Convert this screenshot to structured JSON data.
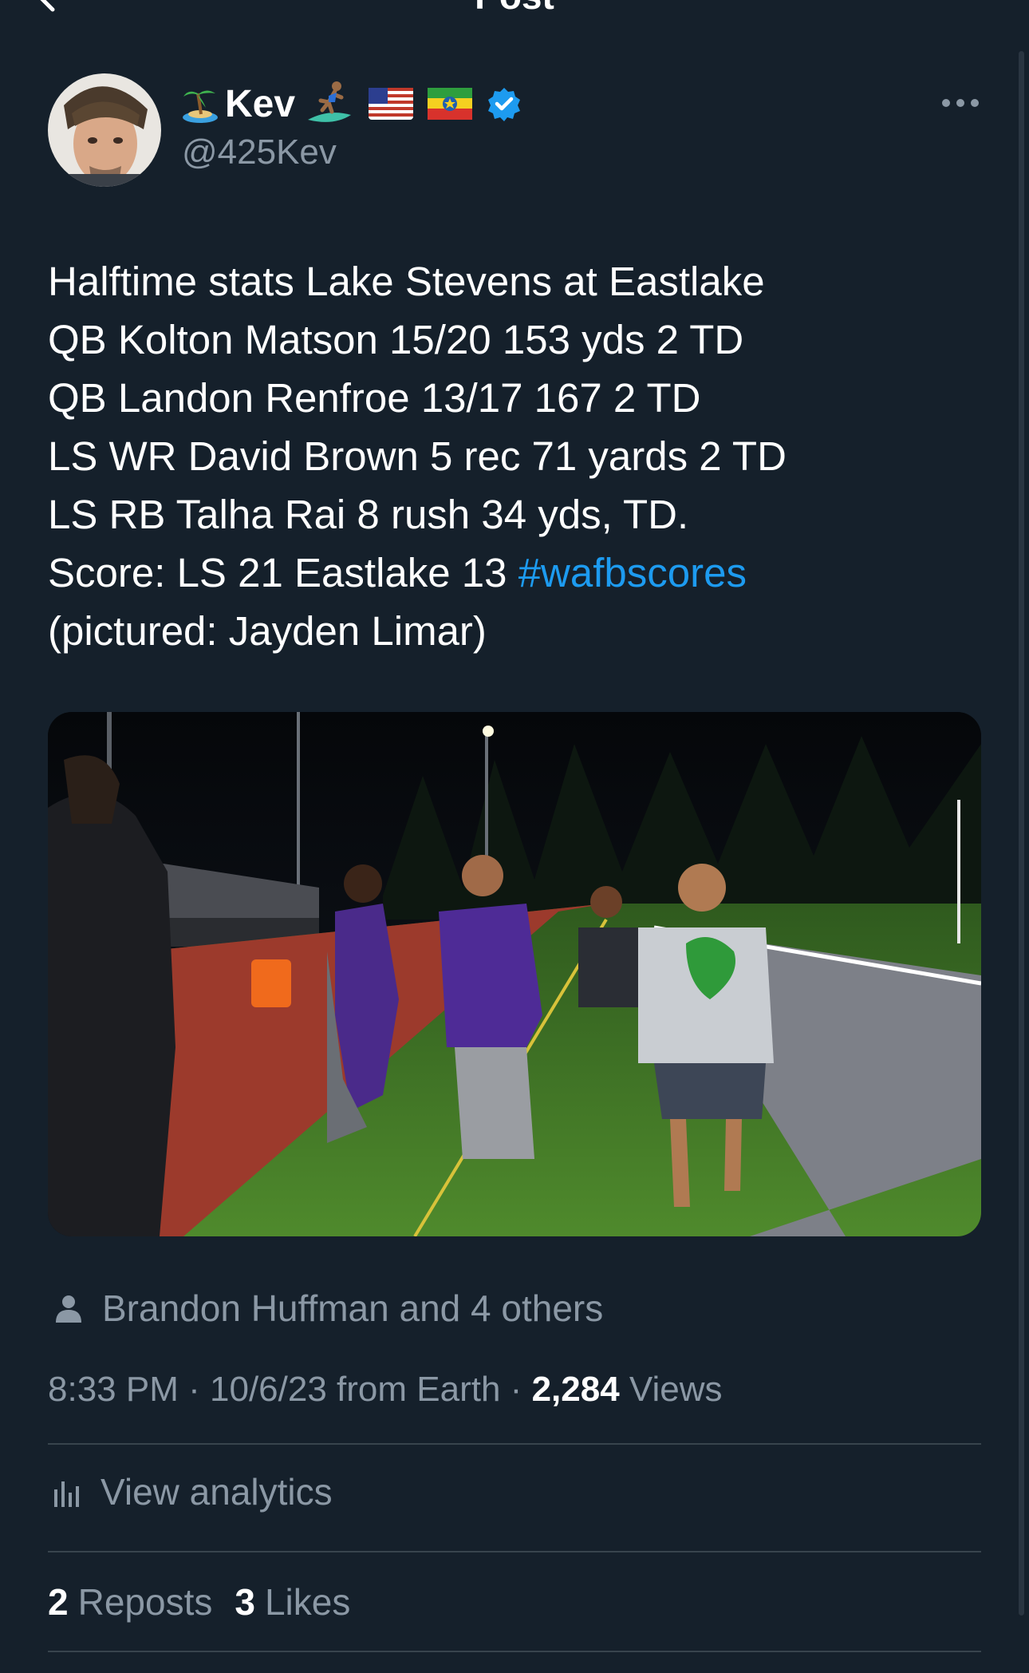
{
  "header": {
    "title": "Post"
  },
  "author": {
    "display_name": "Kev",
    "handle": "@425Kev",
    "emojis": [
      "island-emoji",
      "surfer-emoji",
      "us-flag-emoji",
      "ethiopia-flag-emoji"
    ],
    "verified": true
  },
  "tweet": {
    "lines": [
      "Halftime stats Lake Stevens at Eastlake",
      "QB Kolton Matson 15/20 153 yds 2 TD",
      "QB Landon Renfroe 13/17 167 2 TD",
      "LS WR David Brown 5 rec 71 yards 2 TD",
      "LS RB Talha Rai 8 rush 34 yds, TD."
    ],
    "score_line": "Score: LS 21 Eastlake 13 ",
    "hashtag": "#wafbscores",
    "caption": "(pictured: Jayden Limar)"
  },
  "tagged": {
    "text": "Brandon Huffman and 4 others"
  },
  "meta": {
    "time": "8:33 PM",
    "separator": "·",
    "date": "10/6/23",
    "source": "from Earth",
    "views_count": "2,284",
    "views_label": "Views"
  },
  "analytics": {
    "label": "View analytics"
  },
  "engagement": {
    "reposts_count": "2",
    "reposts_label": "Reposts",
    "likes_count": "3",
    "likes_label": "Likes"
  },
  "colors": {
    "background": "#15202b",
    "text": "#ffffff",
    "secondary": "#8b98a5",
    "accent": "#1d9bf0",
    "divider": "#38444d"
  }
}
